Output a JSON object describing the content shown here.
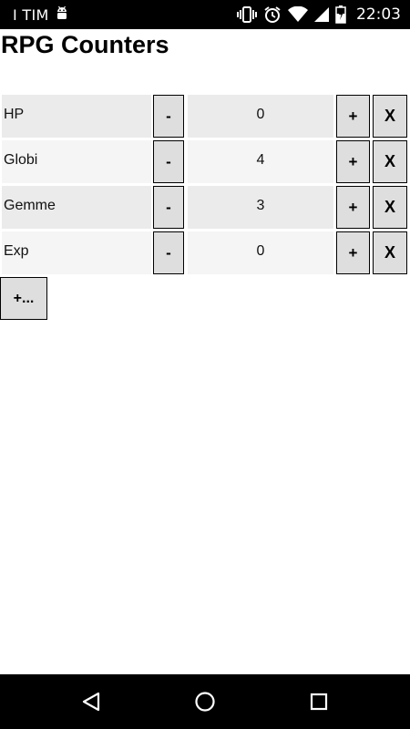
{
  "status_bar": {
    "carrier": "I TIM",
    "time": "22:03",
    "icons": [
      "android-debug-icon",
      "vibrate-icon",
      "alarm-icon",
      "wifi-icon",
      "signal-icon",
      "battery-icon"
    ]
  },
  "app": {
    "title": "RPG Counters"
  },
  "counters": [
    {
      "name": "HP",
      "value": "0",
      "decrement_label": "-",
      "increment_label": "+",
      "delete_label": "X"
    },
    {
      "name": "Globi",
      "value": "4",
      "decrement_label": "-",
      "increment_label": "+",
      "delete_label": "X"
    },
    {
      "name": "Gemme",
      "value": "3",
      "decrement_label": "-",
      "increment_label": "+",
      "delete_label": "X"
    },
    {
      "name": "Exp",
      "value": "0",
      "decrement_label": "-",
      "increment_label": "+",
      "delete_label": "X"
    }
  ],
  "add_button_label": "+...",
  "nav_bar": {
    "buttons": [
      "back-icon",
      "home-icon",
      "recents-icon"
    ]
  },
  "colors": {
    "status_bar_bg": "#000000",
    "row_bg": "#ebebeb",
    "row_alt_bg": "#f5f5f5",
    "button_bg": "#dedede"
  }
}
